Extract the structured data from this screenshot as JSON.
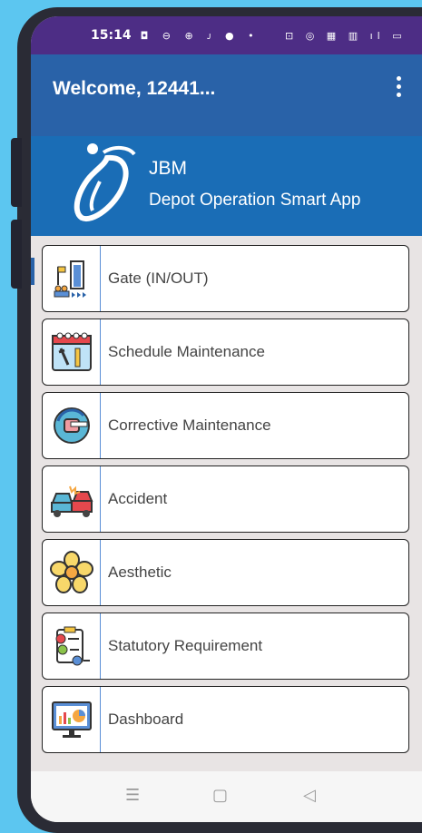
{
  "status_bar": {
    "time": "15:14",
    "left_icons": "◘ ⊖ ⊕ ᴊ ● •",
    "right_icons": "⊡ ◎ ▦ ▥ ıl ▭"
  },
  "app_bar": {
    "title": "Welcome, 12441...",
    "overflow_icon": "more-vert-icon"
  },
  "banner": {
    "brand": "JBM",
    "subtitle": "Depot Operation Smart App"
  },
  "menu": {
    "items": [
      {
        "label": "Gate (IN/OUT)",
        "icon": "gate-icon"
      },
      {
        "label": "Schedule Maintenance",
        "icon": "calendar-tools-icon"
      },
      {
        "label": "Corrective Maintenance",
        "icon": "repair-fist-icon"
      },
      {
        "label": "Accident",
        "icon": "car-crash-icon"
      },
      {
        "label": "Aesthetic",
        "icon": "flower-icon"
      },
      {
        "label": "Statutory Requirement",
        "icon": "checklist-icon"
      },
      {
        "label": "Dashboard",
        "icon": "monitor-chart-icon"
      }
    ]
  },
  "nav_bar": {
    "recents": "☰",
    "home": "▢",
    "back": "◁"
  },
  "colors": {
    "page_bg": "#5cc6f0",
    "status_bar": "#4d2d85",
    "app_bar": "#2962a8",
    "banner": "#1a6db6",
    "list_bg": "#e8e4e4"
  }
}
